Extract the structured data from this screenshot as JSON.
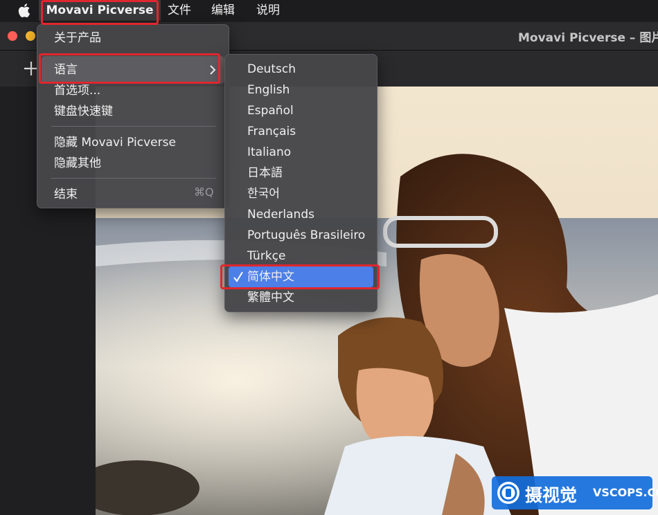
{
  "menubar": {
    "app_name": "Movavi Picverse",
    "items": [
      "文件",
      "编辑",
      "说明"
    ]
  },
  "window": {
    "title": "Movavi Picverse – 图片_"
  },
  "app_menu": {
    "about": "关于产品",
    "language": "语言",
    "preferences": "首选项...",
    "shortcuts": "键盘快速键",
    "hide_app": "隐藏 Movavi Picverse",
    "hide_others": "隐藏其他",
    "quit": "结束",
    "quit_shortcut": "⌘Q"
  },
  "language_menu": {
    "items": [
      "Deutsch",
      "English",
      "Español",
      "Français",
      "Italiano",
      "日本語",
      "한국어",
      "Nederlands",
      "Português Brasileiro",
      "Türkçe",
      "简体中文",
      "繁體中文"
    ],
    "selected": "简体中文"
  },
  "watermark": {
    "cn": "摄视觉",
    "en": "VSCOPS.COM"
  },
  "colors": {
    "highlight": "#4d7fe8",
    "annotation": "#e0262e"
  }
}
